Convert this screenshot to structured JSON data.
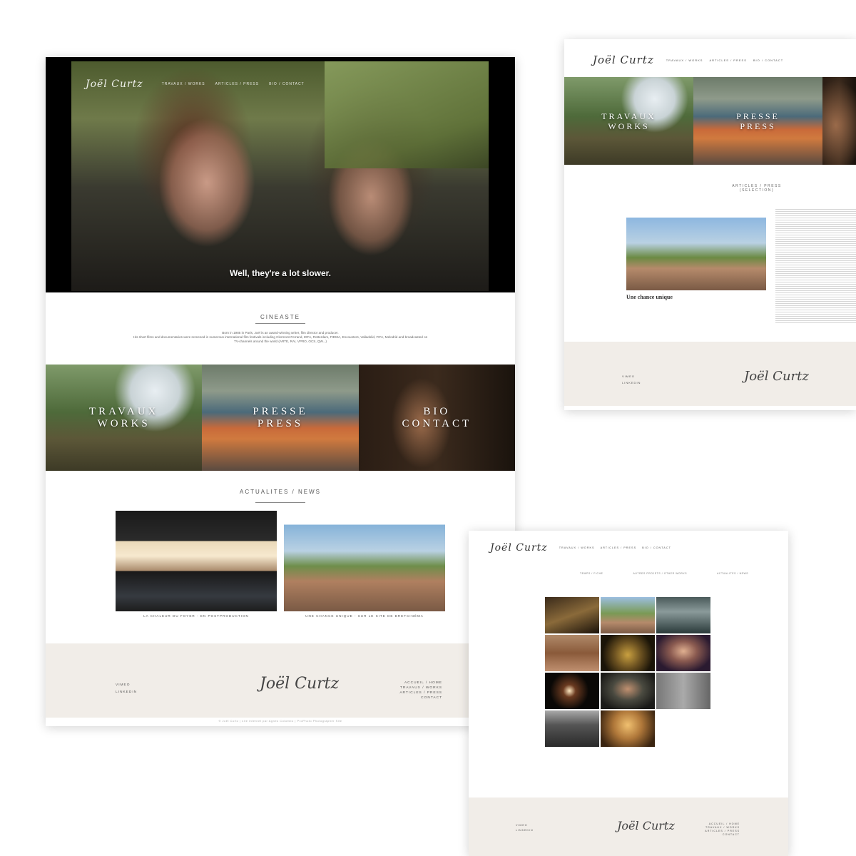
{
  "home": {
    "logo": "Joël Curtz",
    "nav": [
      "TRAVAUX / WORKS",
      "ARTICLES / PRESS",
      "BIO / CONTACT"
    ],
    "hero_subtitle": "Well, they're a lot slower.",
    "cineaste": {
      "title": "CINEASTE",
      "line1": "Born in 1985 in Paris, Joël is an award-winning writer, film director and producer.",
      "line2": "His short films and documentaries were screened in numerous international film festivals including Clermont-Ferrand, IDFA, Rotterdam, FIDMA, Encounters, Valladolid, FIFA, Melodrid and broadcasted on",
      "line3": "TV-channels around the world (ARTE, RAI, VPRO, OCS, QW...)"
    },
    "tiles": [
      {
        "line1": "TRAVAUX",
        "line2": "WORKS"
      },
      {
        "line1": "PRESSE",
        "line2": "PRESS"
      },
      {
        "line1": "BIO",
        "line2": "CONTACT"
      }
    ],
    "news": {
      "title": "ACTUALITES / NEWS",
      "items": [
        {
          "caption": "LA CHALEUR DU FOYER - EN POSTPRODUCTION"
        },
        {
          "caption": "UNE CHANCE UNIQUE - SUR LE SITE DE BREFCINÉMA"
        }
      ]
    },
    "footer": {
      "links_left": [
        "VIMEO",
        "LINKEDIN"
      ],
      "logo": "Joël Curtz",
      "links_right": [
        "ACCUEIL / HOME",
        "TRAVAUX / WORKS",
        "ARTICLES / PRESS",
        "CONTACT"
      ]
    },
    "copyright": "© Joël Curtz | site internet par Agnes Colombo | ProPhoto Photographer Site"
  },
  "articles_page": {
    "logo": "Joël Curtz",
    "nav": [
      "TRAVAUX / WORKS",
      "ARTICLES / PRESS",
      "BIO / CONTACT"
    ],
    "strip": [
      {
        "line1": "TRAVAUX",
        "line2": "WORKS"
      },
      {
        "line1": "PRESSE",
        "line2": "PRESS"
      }
    ],
    "section_title": "ARTICLES / PRESS",
    "section_sub": "(SELECTION)",
    "article_title": "Une chance unique",
    "footer": {
      "links_left": [
        "VIMEO",
        "LINKEDIN"
      ],
      "logo": "Joël Curtz"
    }
  },
  "works_page": {
    "logo": "Joël Curtz",
    "nav": [
      "TRAVAUX / WORKS",
      "ARTICLES / PRESS",
      "BIO / CONTACT"
    ],
    "filters": [
      "TEMPS / FICHE",
      "AUTRES PROJETS / OTHER WORKS",
      "ACTUALITES / NEWS"
    ],
    "footer": {
      "links_left": [
        "VIMEO",
        "LINKEDIN"
      ],
      "logo": "Joël Curtz",
      "links_right": [
        "ACCUEIL / HOME",
        "TRAVAUX / WORKS",
        "ARTICLES / PRESS",
        "CONTACT"
      ]
    }
  }
}
